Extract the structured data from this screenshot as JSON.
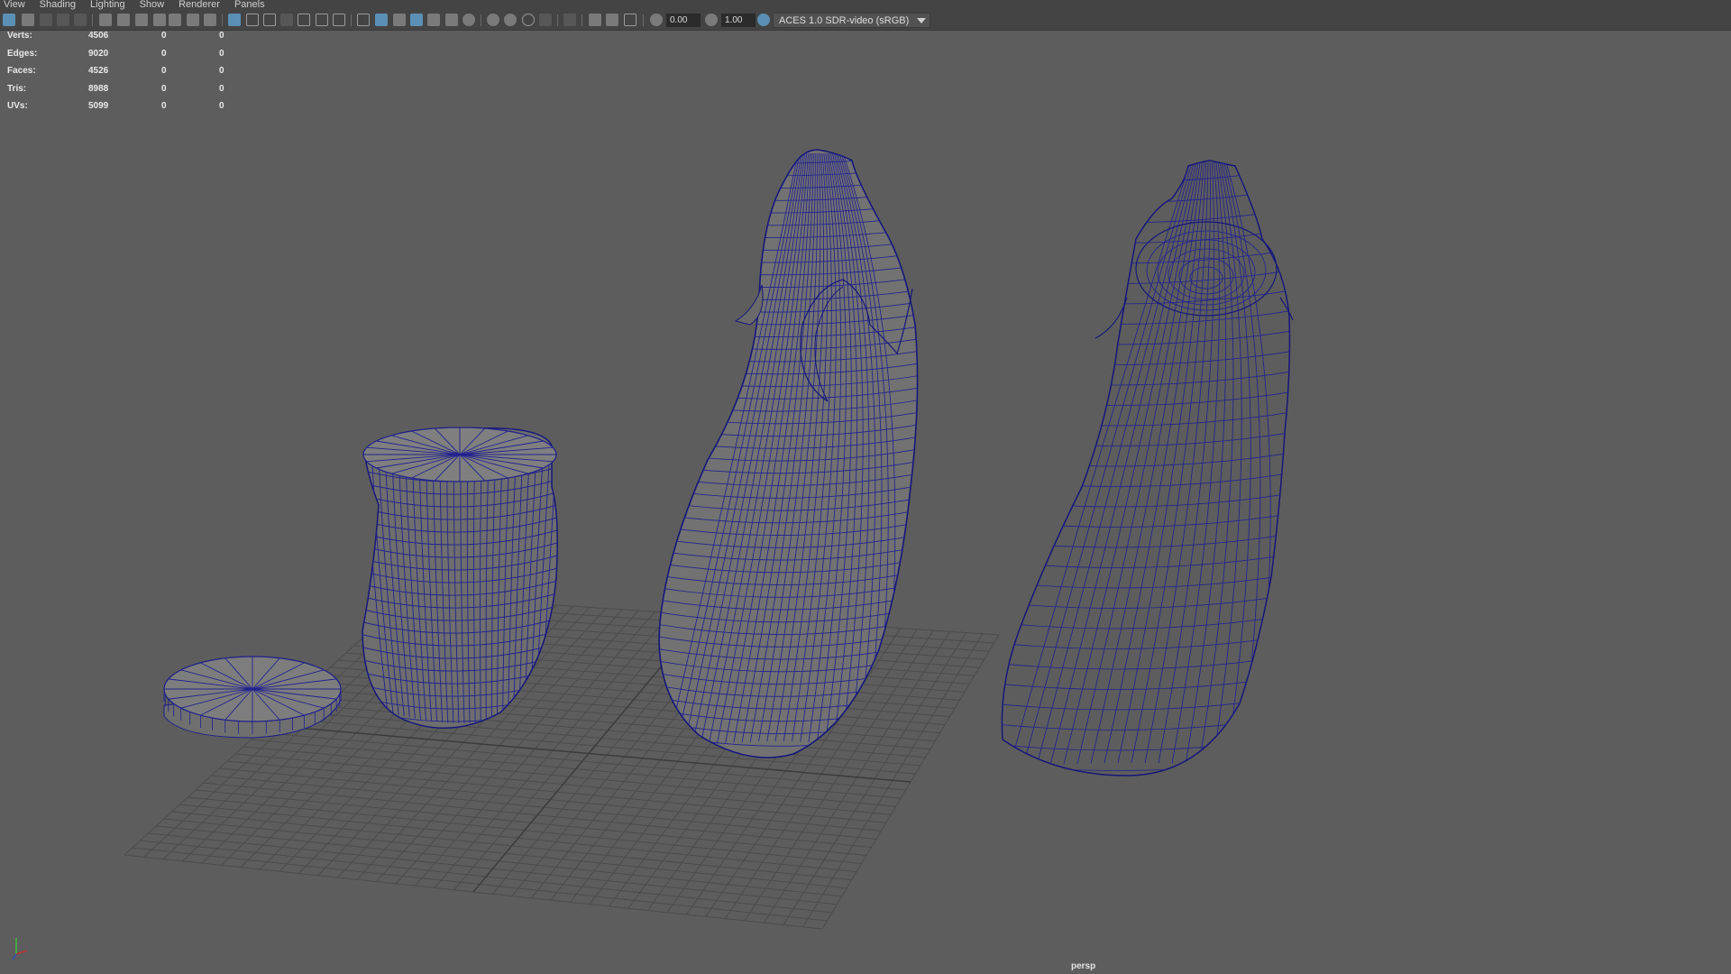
{
  "menu": [
    "View",
    "Shading",
    "Lighting",
    "Show",
    "Renderer",
    "Panels"
  ],
  "toolbar": {
    "exposure": "0.00",
    "gamma": "1.00",
    "colorspace": "ACES 1.0 SDR-video (sRGB)"
  },
  "hud": {
    "rows": [
      {
        "label": "Verts:",
        "values": [
          "4506",
          "0",
          "0"
        ]
      },
      {
        "label": "Edges:",
        "values": [
          "9020",
          "0",
          "0"
        ]
      },
      {
        "label": "Faces:",
        "values": [
          "4526",
          "0",
          "0"
        ]
      },
      {
        "label": "Tris:",
        "values": [
          "8988",
          "0",
          "0"
        ]
      },
      {
        "label": "UVs:",
        "values": [
          "5099",
          "0",
          "0"
        ]
      }
    ]
  },
  "viewport": {
    "camera": "persp",
    "wire_color": "#1f1f8a",
    "shade_color": "#777777",
    "grid_color": "#4a4a4a"
  },
  "axis_gizmo": {
    "x": "x",
    "y": "y",
    "z": "z"
  }
}
